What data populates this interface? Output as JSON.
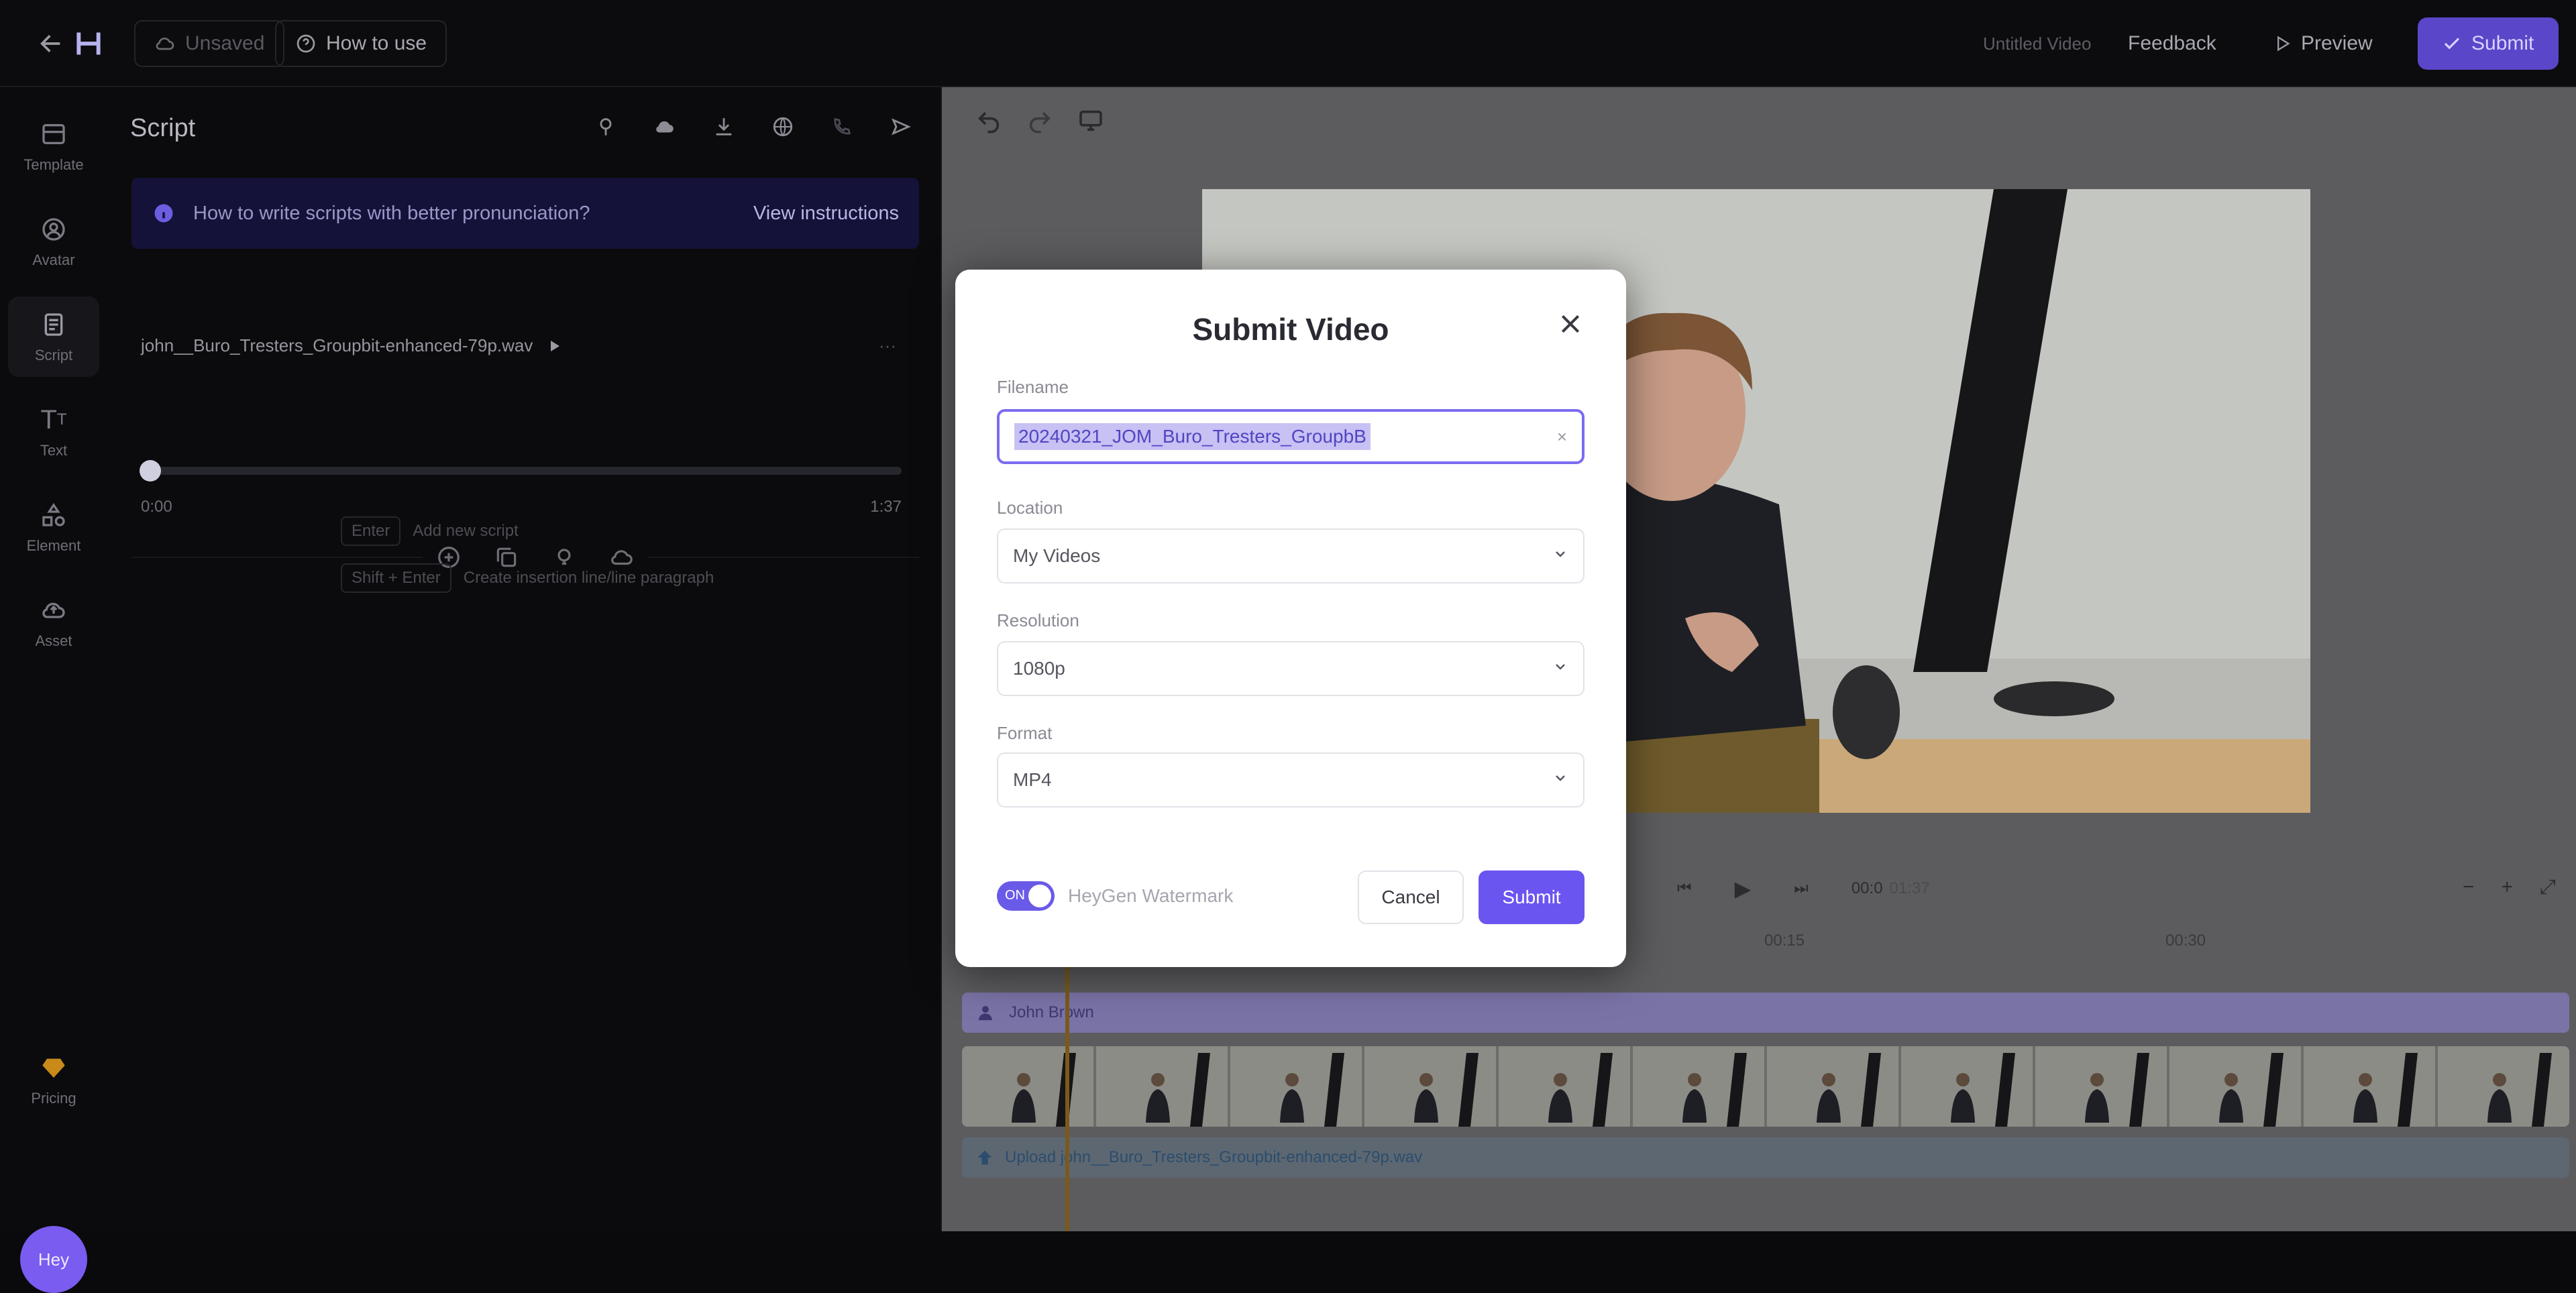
{
  "topbar": {
    "back_icon": "arrow-left-icon",
    "logo_icon": "h-logo-icon",
    "unsaved_label": "Unsaved",
    "how_to_use_label": "How to use",
    "video_title": "Untitled Video",
    "feedback_label": "Feedback",
    "preview_label": "Preview",
    "submit_label": "Submit"
  },
  "rail": {
    "items": [
      {
        "label": "Template",
        "icon": "template-icon"
      },
      {
        "label": "Avatar",
        "icon": "avatar-icon"
      },
      {
        "label": "Script",
        "icon": "script-icon"
      },
      {
        "label": "Text",
        "icon": "text-icon"
      },
      {
        "label": "Element",
        "icon": "element-icon"
      },
      {
        "label": "Asset",
        "icon": "asset-icon"
      }
    ],
    "pricing_label": "Pricing",
    "user_initials": "Hey"
  },
  "script_panel": {
    "title": "Script",
    "banner_text": "How to write scripts with better pronunciation?",
    "banner_link": "View instructions",
    "audio_file": "john__Buro_Tresters_Groupbit-enhanced-79p.wav",
    "time_start": "0:00",
    "time_end": "1:37",
    "hint1_key": "Enter",
    "hint1_text": "Add new script",
    "hint2_key": "Shift + Enter",
    "hint2_text": "Create insertion line/line paragraph"
  },
  "editor": {
    "time_current": "00:0",
    "time_total": "01:37",
    "ruler_marks": [
      "00:15",
      "00:30"
    ],
    "avatar_track_label": "John Brown",
    "audio_track_label": "Upload john__Buro_Tresters_Groupbit-enhanced-79p.wav"
  },
  "modal": {
    "title": "Submit Video",
    "filename_label": "Filename",
    "filename_value": "20240321_JOM_Buro_Tresters_GroupbB",
    "location_label": "Location",
    "location_value": "My Videos",
    "resolution_label": "Resolution",
    "resolution_value": "1080p",
    "format_label": "Format",
    "format_value": "MP4",
    "toggle_on": "ON",
    "watermark_label": "HeyGen Watermark",
    "cancel_label": "Cancel",
    "submit_label": "Submit"
  },
  "colors": {
    "accent": "#6b55f0",
    "topbar_submit": "#5a46c8",
    "dark_bg": "#0b0b0d"
  }
}
